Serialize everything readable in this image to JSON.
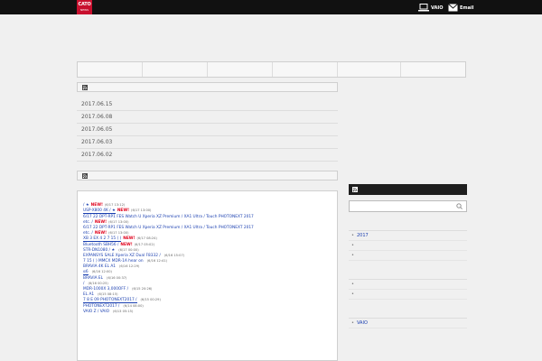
{
  "topbar": {
    "logo_line1": "CATO",
    "logo_line2": "NEWS",
    "links": [
      {
        "label": "VAIO",
        "icon": "laptop-icon"
      },
      {
        "label": "Email",
        "icon": "mail-icon"
      }
    ]
  },
  "header": {
    "site_title": "",
    "site_description": ""
  },
  "nav": {
    "items": [
      {
        "label": ""
      },
      {
        "label": ""
      },
      {
        "label": ""
      },
      {
        "label": ""
      },
      {
        "label": ""
      },
      {
        "label": ""
      }
    ]
  },
  "notices": {
    "heading": "",
    "items": [
      {
        "date": "2017.06.15",
        "title": ""
      },
      {
        "date": "2017.06.08",
        "title": ""
      },
      {
        "date": "2017.06.05",
        "title": ""
      },
      {
        "date": "2017.06.03",
        "title": ""
      },
      {
        "date": "2017.06.02",
        "title": ""
      }
    ]
  },
  "feed": {
    "heading": "",
    "lines": [
      {
        "text": "",
        "new": "",
        "time": ""
      },
      {
        "text": "/ ★",
        "new": "NEW!",
        "time": "(6/17 13:12)"
      },
      {
        "text": "USP-X800  4K  / ★",
        "new": "NEW!",
        "time": "(6/17 13:00)"
      },
      {
        "text": "6/17 22  DPT-RP1  FES Watch U  Xperia XZ Premium / XA1 Ultra / Touch  PHOTONEXT 2017",
        "new": "",
        "time": ""
      },
      {
        "text": "etc. /",
        "new": "NEW!",
        "time": "(6/17 13:00)"
      },
      {
        "text": "6/17 22  DPT-RP1  FES Watch U  Xperia XZ Premium / XA1 Ultra / Touch  PHOTONEXT 2017",
        "new": "",
        "time": ""
      },
      {
        "text": "etc. /",
        "new": "NEW!",
        "time": "(6/17 13:00)"
      },
      {
        "text": "XB  3  EX  4  2  7 15 ( )",
        "new": "NEW!",
        "time": "(6/17 08:24)"
      },
      {
        "text": "Bluetooth  SBH56  /",
        "new": "NEW!",
        "time": "(6/17 05:02)"
      },
      {
        "text": "STR-DN1080  / ★",
        "new": "",
        "time": "(6/17 00:00)"
      },
      {
        "text": "EXPANSYS  SALE  Xperia XZ Dual F8332  /",
        "new": "",
        "time": "(6/16 15:07)"
      },
      {
        "text": "7 15 ( )  MMCX  MDR-1A hear on",
        "new": "",
        "time": "(6/16 12:41)"
      },
      {
        "text": "BRAVIA 4K  EL  A1",
        "new": "",
        "time": "(6/16 12:29)"
      },
      {
        "text": "α6",
        "new": "",
        "time": "(6/16 12:00)"
      },
      {
        "text": "BRAVIA  EL",
        "new": "",
        "time": "(6/16 00:37)"
      },
      {
        "text": "/",
        "new": "",
        "time": "(6/16 00:25)"
      },
      {
        "text": "MDR-1000X  3,000OFF  /",
        "new": "",
        "time": "(6/15 20:26)"
      },
      {
        "text": "EL  A1",
        "new": "",
        "time": "(6/15 08:15)"
      },
      {
        "text": "7 8  E  09  PHOTONEXT2017  /",
        "new": "",
        "time": "(6/15 00:29)"
      },
      {
        "text": "PHOTONEXT2017  /",
        "new": "",
        "time": "(6/14 08:00)"
      },
      {
        "text": "VAIO Z  / VAIO",
        "new": "",
        "time": "(6/13 05:15)"
      }
    ]
  },
  "sidebar": {
    "rss_heading": "",
    "search_placeholder": "",
    "blocks": [
      {
        "title": "",
        "items": [
          {
            "label": "2017"
          },
          {
            "label": ""
          },
          {
            "label": ""
          }
        ]
      },
      {
        "title": "",
        "items": [
          {
            "label": ""
          },
          {
            "label": ""
          }
        ]
      },
      {
        "title": "",
        "items": [
          {
            "label": "VAIO"
          }
        ]
      }
    ]
  },
  "colors": {
    "topbar": "#111111",
    "logo_red": "#c8102e",
    "link_blue": "#1a3fb0",
    "new_red": "#e0001b"
  }
}
